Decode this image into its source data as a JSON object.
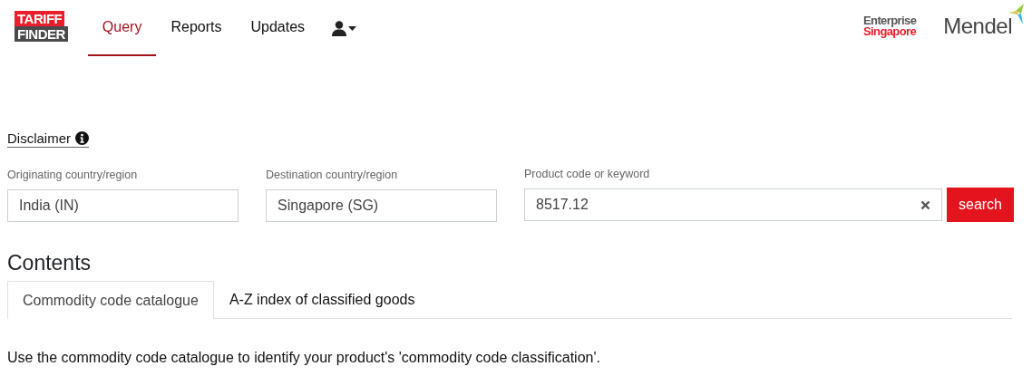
{
  "header": {
    "logo": [
      "TARIFF",
      "FINDER"
    ],
    "nav": [
      {
        "label": "Query",
        "selected": true
      },
      {
        "label": "Reports",
        "selected": false
      },
      {
        "label": "Updates",
        "selected": false
      }
    ],
    "partners": [
      {
        "kind": "enterprise",
        "lines": [
          "Enterprise",
          "Singapore"
        ]
      },
      {
        "kind": "mendel",
        "lines": [
          "Mendel"
        ]
      }
    ]
  },
  "disclaimer": "Disclaimer",
  "fields": [
    {
      "label": "Originating country/region",
      "value": "India (IN)",
      "clearable": false
    },
    {
      "label": "Destination country/region",
      "value": "Singapore (SG)",
      "clearable": false
    },
    {
      "label": "Product code or keyword",
      "value": "8517.12",
      "clearable": true
    }
  ],
  "search_button": "search",
  "contents": {
    "title": "Contents",
    "tabs": [
      {
        "label": "Commodity code catalogue",
        "selected": true
      },
      {
        "label": "A-Z index of classified goods",
        "selected": false
      }
    ],
    "text": "Use the commodity code catalogue to identify your product's 'commodity code classification'."
  }
}
